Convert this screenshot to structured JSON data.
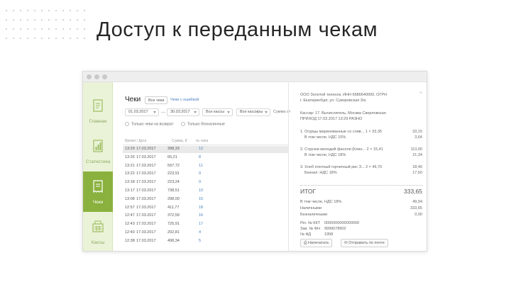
{
  "slide": {
    "title": "Доступ к переданным чекам"
  },
  "sidebar": {
    "items": [
      {
        "label": "Главная",
        "icon": "document-icon",
        "active": false
      },
      {
        "label": "Статистика",
        "icon": "bar-chart-icon",
        "active": false
      },
      {
        "label": "Чеки",
        "icon": "receipt-icon",
        "active": true
      },
      {
        "label": "Кассы",
        "icon": "register-icon",
        "active": false
      }
    ]
  },
  "list": {
    "title": "Чеки",
    "btn_all": "Все чеки",
    "link_errors": "Чеки с ошибкой",
    "filters": {
      "date_from": "01.03.2017",
      "sep": "—",
      "date_to": "30.03.2017",
      "select_1": "Все кассы",
      "select_2": "Все кассиры",
      "sum_label": "Сумма от"
    },
    "checks": {
      "only_returns": "Только чеки на возврат",
      "only_cashless": "Только безналичные"
    },
    "columns": {
      "time": "Время / Дата",
      "sum": "Сумма, ₽",
      "check_no": "№ чека"
    },
    "rows": [
      {
        "time": "13:29",
        "date": "17.03.2017",
        "sum": "398,33",
        "no": "12"
      },
      {
        "time": "13:26",
        "date": "17.03.2017",
        "sum": "65,21",
        "no": "8"
      },
      {
        "time": "13:21",
        "date": "17.03.2017",
        "sum": "597,72",
        "no": "11"
      },
      {
        "time": "13:22",
        "date": "17.03.2017",
        "sum": "223,91",
        "no": "9"
      },
      {
        "time": "13:18",
        "date": "17.03.2017",
        "sum": "223,24",
        "no": "9"
      },
      {
        "time": "13:17",
        "date": "17.03.2017",
        "sum": "738,51",
        "no": "10"
      },
      {
        "time": "13:08",
        "date": "17.03.2017",
        "sum": "298,00",
        "no": "15"
      },
      {
        "time": "12:57",
        "date": "17.03.2017",
        "sum": "411,77",
        "no": "18"
      },
      {
        "time": "12:47",
        "date": "17.03.2017",
        "sum": "372,59",
        "no": "16"
      },
      {
        "time": "12:43",
        "date": "17.03.2017",
        "sum": "725,91",
        "no": "17"
      },
      {
        "time": "12:40",
        "date": "17.03.2017",
        "sum": "202,81",
        "no": "4"
      },
      {
        "time": "12:38",
        "date": "17.03.2017",
        "sum": "498,34",
        "no": "5"
      }
    ]
  },
  "receipt": {
    "close": "×",
    "header_1": "ООО Золотой теленок, ИНН 6686640000, ОГРН",
    "header_2": "г. Екатеринбург, ул. Суворовская 3/а",
    "meta_1": "Кассир: 17. Вычислитель, Москва Сверловская",
    "meta_2": "ПРИХОД 17.03.2017 13:29 РАЗНО",
    "items": [
      {
        "name": "1. Огурцы маринованные со слив... 1 × 33,35",
        "price": "33,15",
        "vat_label": "В том числе, НДС 10%",
        "vat": "3,64"
      },
      {
        "name": "2. Стручки молодой фасоли (Клин... 2 × 15,41",
        "price": "113,00",
        "vat_label": "В том числе, НДС 18%",
        "vat": "21,34"
      },
      {
        "name": "3. Хлеб плотный горчичный рис З... 2 × 46,70",
        "price": "18,40",
        "vat_label": "Безнал: НДС 18%",
        "vat": "17,50"
      }
    ],
    "total_label": "ИТОГ",
    "total_value": "333,65",
    "sum_rows": [
      {
        "label": "В том числе, НДС 18%",
        "value": "49,94"
      },
      {
        "label": "Наличными",
        "value": "333,65"
      },
      {
        "label": "Безналичными",
        "value": "0,00"
      }
    ],
    "codes": [
      {
        "label": "Рег. № ККТ",
        "value": "0000000000000000"
      },
      {
        "label": "Зав. № ФН",
        "value": "9999078902"
      },
      {
        "label": "№ ФД",
        "value": "1958"
      }
    ],
    "btn_print": "Напечатать",
    "btn_send": "Отправить по почте"
  }
}
